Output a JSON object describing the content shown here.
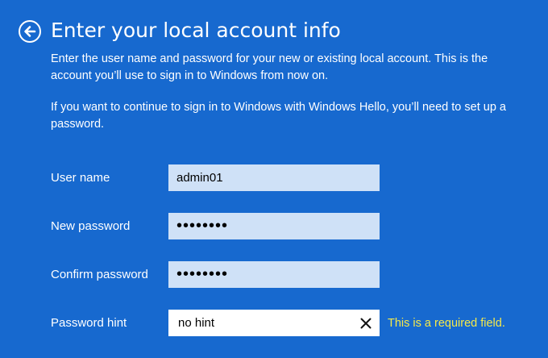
{
  "header": {
    "title": "Enter your local account info"
  },
  "description": {
    "paragraph1": "Enter the user name and password for your new or existing local account. This is the account you’ll use to sign in to Windows from now on.",
    "paragraph2": "If you want to continue to sign in to Windows with Windows Hello, you’ll need to set up a password."
  },
  "form": {
    "username": {
      "label": "User name",
      "value": "admin01"
    },
    "new_password": {
      "label": "New password",
      "value": "password"
    },
    "confirm_password": {
      "label": "Confirm password",
      "value": "password"
    },
    "password_hint": {
      "label": "Password hint",
      "value": "no hint",
      "error": "This is a required field."
    }
  },
  "icons": {
    "back": "back-arrow-icon",
    "clear": "close-icon"
  },
  "colors": {
    "background": "#1769cf",
    "field_background": "#cfe1f7",
    "error_text": "#f5e94a"
  }
}
